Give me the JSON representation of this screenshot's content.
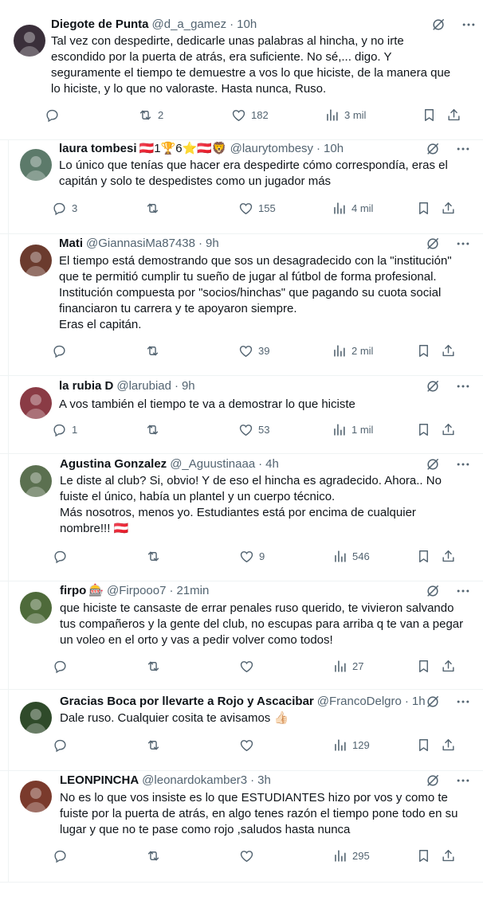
{
  "tweets": [
    {
      "name": "Diegote de Punta",
      "handle": "@d_a_gamez",
      "time": "10h",
      "emojis": "",
      "text": "Tal vez con despedirte, dedicarle unas palabras al hincha, y no irte\nescondido por la puerta de atrás, era suficiente. No sé,... digo. Y\nseguramente el tiempo te demuestre a vos lo que hiciste, de la manera que\nlo hiciste, y lo que no valoraste. Hasta nunca, Ruso.",
      "replies": "",
      "retweets": "2",
      "likes": "182",
      "views": "3 mil",
      "avatar_color": "#3a2f3a"
    },
    {
      "name": "laura tombesi",
      "handle": "@laurytombesy",
      "time": "10h",
      "emojis": "🇦🇹1🏆6⭐🇦🇹🦁",
      "text": "Lo único que tenías que hacer era despedirte cómo correspondía, eras el\ncapitán y solo te despedistes como un jugador más",
      "replies": "3",
      "retweets": "",
      "likes": "155",
      "views": "4 mil",
      "avatar_color": "#5c7a6a"
    },
    {
      "name": "Mati",
      "handle": "@GiannasiMa87438",
      "time": "9h",
      "emojis": "",
      "text": "El tiempo está demostrando que sos un desagradecido con la \"institución\"\nque te permitió cumplir tu sueño de jugar al fútbol de forma profesional.\nInstitución compuesta por \"socios/hinchas\" que pagando su cuota social\nfinanciaron tu carrera y te apoyaron siempre.\nEras el capitán.",
      "replies": "",
      "retweets": "",
      "likes": "39",
      "views": "2 mil",
      "avatar_color": "#6b3b2e"
    },
    {
      "name": "la rubia D",
      "handle": "@larubiad",
      "time": "9h",
      "emojis": "",
      "text": "A vos también el tiempo te va a demostrar lo que hiciste",
      "replies": "1",
      "retweets": "",
      "likes": "53",
      "views": "1 mil",
      "avatar_color": "#8a3b45"
    },
    {
      "name": "Agustina Gonzalez",
      "handle": "@_Aguustinaaa",
      "time": "4h",
      "emojis": "",
      "text": "Le diste al club? Si, obvio! Y de eso el hincha es agradecido. Ahora.. No\nfuiste el único, había un plantel y un cuerpo técnico.\nMás nosotros, menos yo. Estudiantes está por encima de cualquier\nnombre!!! 🇦🇹",
      "replies": "",
      "retweets": "",
      "likes": "9",
      "views": "546",
      "avatar_color": "#5b7050"
    },
    {
      "name": "firpo",
      "handle": "@Firpooo7",
      "time": "21min",
      "emojis": "🎰",
      "text": "que hiciste te cansaste de errar penales ruso querido, te vivieron salvando\ntus compañeros y la gente del club, no escupas para arriba q te van a pegar\nun voleo en el orto y vas a pedir volver como todos!",
      "replies": "",
      "retweets": "",
      "likes": "",
      "views": "27",
      "avatar_color": "#4e6a3a"
    },
    {
      "name": "Gracias Boca por llevarte a Rojo y Ascacibar",
      "handle": "@FrancoDelgro",
      "time": "1h",
      "emojis": "",
      "text": "Dale ruso. Cualquier cosita te avisamos 👍🏻",
      "replies": "",
      "retweets": "",
      "likes": "",
      "views": "129",
      "avatar_color": "#2f4a2a"
    },
    {
      "name": "LEONPINCHA",
      "handle": "@leonardokamber3",
      "time": "3h",
      "emojis": "",
      "text": "No es lo que vos insiste es lo que ESTUDIANTES hizo por vos y como te\nfuiste por la puerta de atrás, en algo tenes razón el tiempo pone todo en su\nlugar y que no te pase como rojo ,saludos hasta nunca",
      "replies": "",
      "retweets": "",
      "likes": "",
      "views": "295",
      "avatar_color": "#7a3a2c"
    }
  ]
}
